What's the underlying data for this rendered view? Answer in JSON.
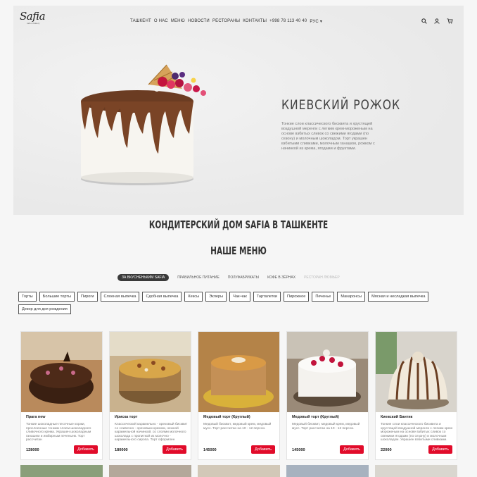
{
  "logo": {
    "name": "Safia",
    "tagline": "café & bakery"
  },
  "nav": {
    "items": [
      "ТАШКЕНТ",
      "О НАС",
      "МЕНЮ",
      "НОВОСТИ",
      "РЕСТОРАНЫ",
      "КОНТАКТЫ",
      "+998 78 113 40 40"
    ],
    "language": "РУС",
    "icons": [
      "search-icon",
      "user-icon",
      "cart-icon"
    ]
  },
  "hero": {
    "title": "КИЕВСКИЙ РОЖОК",
    "text": "Тонкие слои классического бисквита и хрустящей воздушной меренги с легким крем-мороженым на основе взбитых сливок со свежими ягодами (по сезону) и молочным шоколадом. Торт украшен взбитыми сливками, молочным ганашом, рожком с начинкой из крема, ягодами и фруктами."
  },
  "headings": {
    "house": "КОНДИТЕРСКИЙ ДОМ SAFIA В ТАШКЕНТЕ",
    "menu": "НАШЕ МЕНЮ"
  },
  "categories": [
    "ЗА ВКУСНЕНЬКИМ SAFIA",
    "ПРАВИЛЬНОЕ ПИТАНИЕ",
    "ПОЛУФАБРИКАТЫ",
    "КОФЕ В ЗЁРНАХ",
    "РЕСТОРАН ЛЮМЬЕР"
  ],
  "tags": [
    "Торты",
    "Большие торты",
    "Пироги",
    "Слоеная выпечка",
    "Сдобная выпечка",
    "Кексы",
    "Эклеры",
    "Чак-чак",
    "Тарталетки",
    "Пирожное",
    "Печенье",
    "Макаронсы",
    "Мясная и несладкая выпечка",
    "Декор для дня рождения"
  ],
  "products": [
    {
      "name": "Прага new",
      "desc": "Тонкие шоколадные песочные коржи, прослоенные тонким слоем шоколадного сливочного крема. Украшен шоколадным ганашем и имбирным печеньем. Торт рассчитан",
      "price": "128000",
      "button": "Добавить"
    },
    {
      "name": "Ириска торт",
      "desc": "Классический карамельно - ореховый бисквит со сливочно - ореховым кремом, нежной карамельной начинкой, со слоями молочного шоколада с пропиткой из молочно - карамельного сиропа. Торт оформлен",
      "price": "180000",
      "button": "Добавить"
    },
    {
      "name": "Медовый торт (Круглый)",
      "desc": "Медовый бисквит, медовый крем, медовый мусс. Торт рассчитан на 10 - 12 персон.",
      "price": "145000",
      "button": "Добавить"
    },
    {
      "name": "Медовый торт (Круглый)",
      "desc": "Медовый бисквит, медовый крем, медовый мусс. Торт рассчитан на 10 - 12 персон.",
      "price": "145000",
      "button": "Добавить"
    },
    {
      "name": "Киевский Бантик",
      "desc": "Тонкие слои классического бисквита и хрустящей воздушной меренги с легким крем-мороженым на основе взбитых сливок со свежими ягодами (по сезону) и молочным шоколадом. Украшен взбитыми сливками.",
      "price": "22000",
      "button": "Добавить"
    }
  ]
}
